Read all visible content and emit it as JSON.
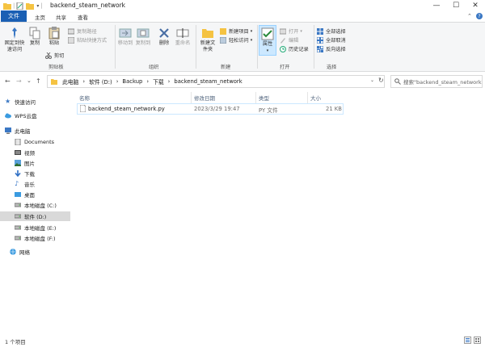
{
  "window": {
    "title": "backend_steam_network",
    "minimize": "—",
    "maximize": "☐",
    "close": "✕"
  },
  "tabs": {
    "file": "文件",
    "home": "主页",
    "share": "共享",
    "view": "查看"
  },
  "ribbon": {
    "clipboard": {
      "pin_label": "固定到快速访问",
      "copy_label": "复制",
      "paste_label": "粘贴",
      "copy_path": "复制路径",
      "paste_shortcut": "粘贴快捷方式",
      "cut": "剪切",
      "group_label": "剪贴板"
    },
    "organize": {
      "move_to": "移动到",
      "copy_to": "复制到",
      "delete": "删除",
      "rename": "重命名",
      "group_label": "组织"
    },
    "new": {
      "new_folder": "新建文件夹",
      "new_item": "新建项目",
      "easy_access": "轻松访问",
      "group_label": "新建"
    },
    "open": {
      "properties": "属性",
      "open": "打开",
      "edit": "编辑",
      "history": "历史记录",
      "group_label": "打开"
    },
    "select": {
      "select_all": "全部选择",
      "select_none": "全部取消",
      "invert": "反向选择",
      "group_label": "选择"
    }
  },
  "nav": {
    "back": "←",
    "forward": "→",
    "up_arrow": "⌄",
    "up": "↑"
  },
  "address": {
    "segments": [
      "此电脑",
      "›",
      "软件 (D:)",
      "›",
      "Backup",
      "›",
      "下载",
      "›",
      "backend_steam_network"
    ],
    "search_placeholder": "搜索\"backend_steam_network\""
  },
  "sidebar": {
    "items": [
      {
        "label": "快速访问"
      },
      {
        "label": "WPS云盘"
      },
      {
        "label": "此电脑"
      },
      {
        "label": "Documents"
      },
      {
        "label": "视频"
      },
      {
        "label": "图片"
      },
      {
        "label": "下载"
      },
      {
        "label": "音乐"
      },
      {
        "label": "桌面"
      },
      {
        "label": "本地磁盘 (C:)"
      },
      {
        "label": "软件 (D:)"
      },
      {
        "label": "本地磁盘 (E:)"
      },
      {
        "label": "本地磁盘 (F:)"
      },
      {
        "label": "网络"
      }
    ]
  },
  "columns": {
    "name": "名称",
    "date": "修改日期",
    "type": "类型",
    "size": "大小"
  },
  "files": [
    {
      "name": "backend_steam_network.py",
      "date": "2023/3/29 19:47",
      "type": "PY 文件",
      "size": "21 KB"
    }
  ],
  "status": {
    "count": "1 个项目"
  },
  "colors": {
    "accent": "#1a5fb4",
    "selected": "#d9d9d9"
  }
}
